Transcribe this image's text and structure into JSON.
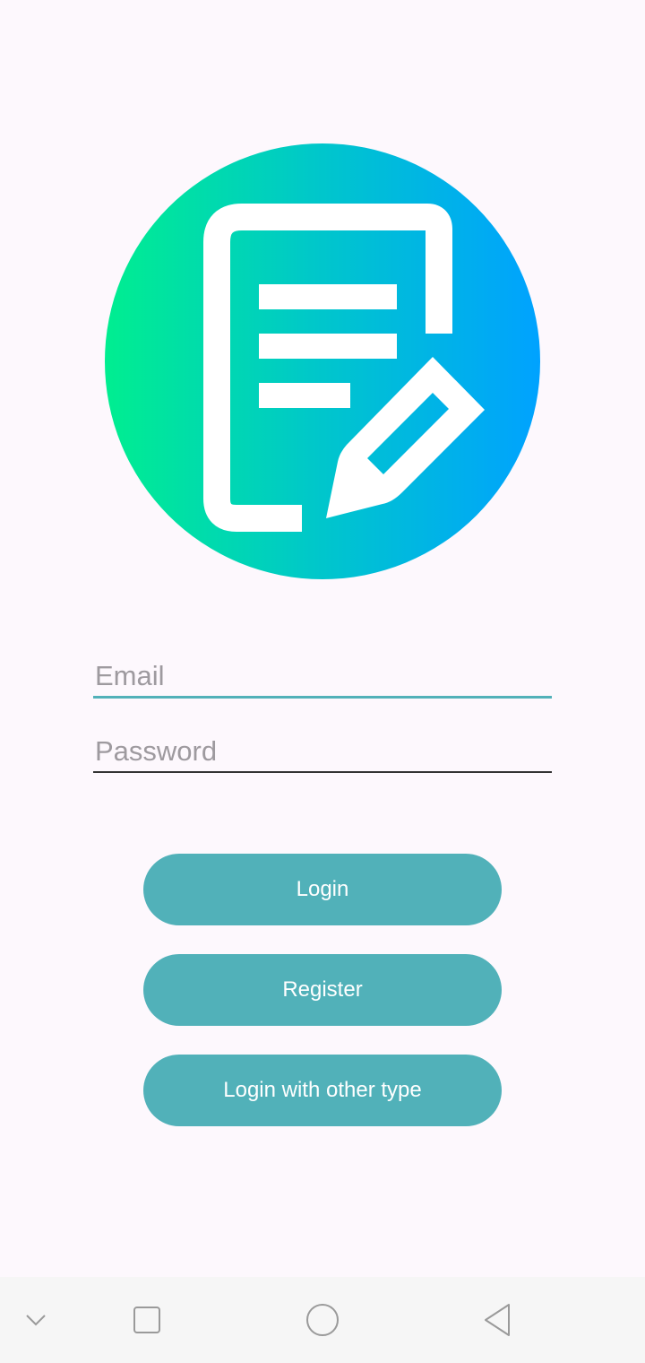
{
  "login_form": {
    "email_placeholder": "Email",
    "email_value": "",
    "password_placeholder": "Password",
    "password_value": ""
  },
  "buttons": {
    "login_label": "Login",
    "register_label": "Register",
    "other_login_label": "Login with other type"
  },
  "logo": {
    "icon": "document-edit-icon",
    "gradient_start": "#00ee90",
    "gradient_end": "#00a2ff"
  },
  "navigation_bar": {
    "icons": [
      "chevron-down-icon",
      "recent-apps-icon",
      "home-icon",
      "back-icon"
    ]
  },
  "colors": {
    "accent": "#51b1b9",
    "background": "#fdf8fd",
    "placeholder": "#9e9a9f"
  }
}
